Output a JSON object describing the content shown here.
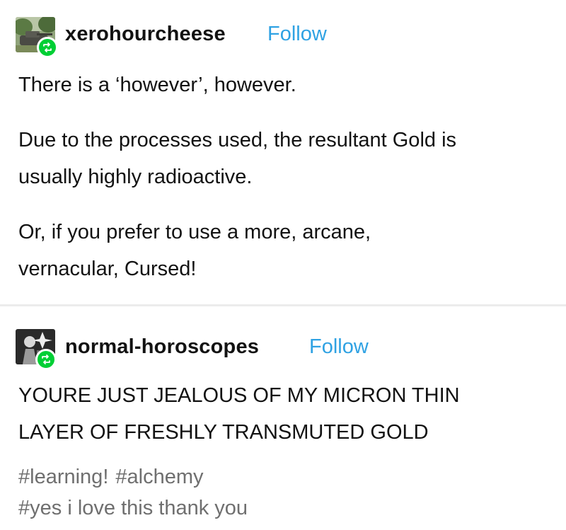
{
  "posts": [
    {
      "username": "xerohourcheese",
      "follow_label": "Follow",
      "paragraphs": [
        "There is a ‘however’, however.",
        "Due to the processes used, the resultant Gold is",
        "usually highly radioactive.",
        "Or, if you prefer to use a more, arcane,",
        "vernacular, Cursed!"
      ]
    },
    {
      "username": "normal-horoscopes",
      "follow_label": "Follow",
      "lines": [
        "YOURE JUST JEALOUS OF MY MICRON THIN",
        "LAYER OF FRESHLY TRANSMUTED GOLD"
      ]
    }
  ],
  "tags": {
    "row1": [
      "#learning!",
      "#alchemy"
    ],
    "row2": [
      "#yes i love this thank you"
    ]
  },
  "colors": {
    "follow": "#2fa2e3",
    "reblog_badge": "#00cf35",
    "tag_text": "#6f6f6f"
  },
  "icons": {
    "reblog": "reblog-icon"
  }
}
